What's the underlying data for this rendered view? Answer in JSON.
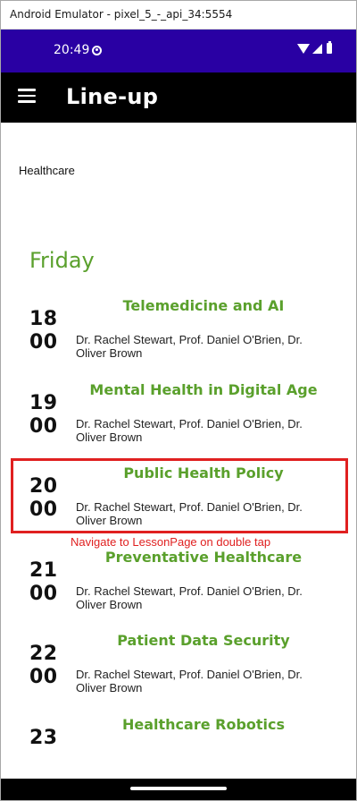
{
  "window": {
    "title": "Android Emulator - pixel_5_-_api_34:5554"
  },
  "status_bar": {
    "time": "20:49",
    "icons": [
      "circle-status-icon",
      "wifi-icon",
      "signal-icon",
      "battery-icon"
    ]
  },
  "app_bar": {
    "title": "Line-up",
    "menu_icon": "hamburger-menu-icon"
  },
  "category": "Healthcare",
  "day": "Friday",
  "sessions": [
    {
      "hour": "18",
      "minutes": "00",
      "title": "Telemedicine and AI",
      "speakers": "Dr. Rachel Stewart, Prof. Daniel O'Brien, Dr. Oliver Brown"
    },
    {
      "hour": "19",
      "minutes": "00",
      "title": "Mental Health in Digital Age",
      "speakers": "Dr. Rachel Stewart, Prof. Daniel O'Brien, Dr. Oliver Brown"
    },
    {
      "hour": "20",
      "minutes": "00",
      "title": "Public Health Policy",
      "speakers": "Dr. Rachel Stewart, Prof. Daniel O'Brien, Dr. Oliver Brown"
    },
    {
      "hour": "21",
      "minutes": "00",
      "title": "Preventative Healthcare",
      "speakers": "Dr. Rachel Stewart, Prof. Daniel O'Brien, Dr. Oliver Brown"
    },
    {
      "hour": "22",
      "minutes": "00",
      "title": "Patient Data Security",
      "speakers": "Dr. Rachel Stewart, Prof. Daniel O'Brien, Dr. Oliver Brown"
    },
    {
      "hour": "23",
      "minutes": "",
      "title": "Healthcare Robotics",
      "speakers": ""
    }
  ],
  "annotation": "Navigate to LessonPage on double tap",
  "colors": {
    "status_bar": "#2900a3",
    "app_bar": "#000000",
    "accent_green": "#5aa02c",
    "annotation_red": "#e02020"
  }
}
